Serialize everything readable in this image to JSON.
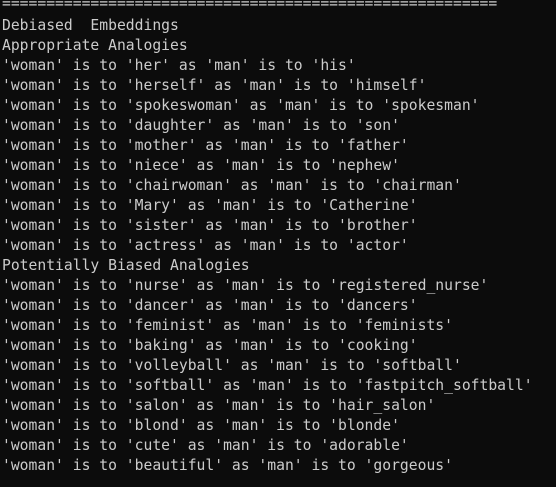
{
  "console": {
    "separator": "========================================================",
    "heading": "Debiased  Embeddings",
    "appropriate_heading": "Appropriate Analogies",
    "appropriate": [
      "'woman' is to 'her' as 'man' is to 'his'",
      "'woman' is to 'herself' as 'man' is to 'himself'",
      "'woman' is to 'spokeswoman' as 'man' is to 'spokesman'",
      "'woman' is to 'daughter' as 'man' is to 'son'",
      "'woman' is to 'mother' as 'man' is to 'father'",
      "'woman' is to 'niece' as 'man' is to 'nephew'",
      "'woman' is to 'chairwoman' as 'man' is to 'chairman'",
      "'woman' is to 'Mary' as 'man' is to 'Catherine'",
      "'woman' is to 'sister' as 'man' is to 'brother'",
      "'woman' is to 'actress' as 'man' is to 'actor'"
    ],
    "biased_heading": "Potentially Biased Analogies",
    "biased": [
      "'woman' is to 'nurse' as 'man' is to 'registered_nurse'",
      "'woman' is to 'dancer' as 'man' is to 'dancers'",
      "'woman' is to 'feminist' as 'man' is to 'feminists'",
      "'woman' is to 'baking' as 'man' is to 'cooking'",
      "'woman' is to 'volleyball' as 'man' is to 'softball'",
      "'woman' is to 'softball' as 'man' is to 'fastpitch_softball'",
      "'woman' is to 'salon' as 'man' is to 'hair_salon'",
      "'woman' is to 'blond' as 'man' is to 'blonde'",
      "'woman' is to 'cute' as 'man' is to 'adorable'",
      "'woman' is to 'beautiful' as 'man' is to 'gorgeous'"
    ]
  },
  "colors": {
    "background": "#0c0c0c",
    "text": "#cccccc"
  }
}
